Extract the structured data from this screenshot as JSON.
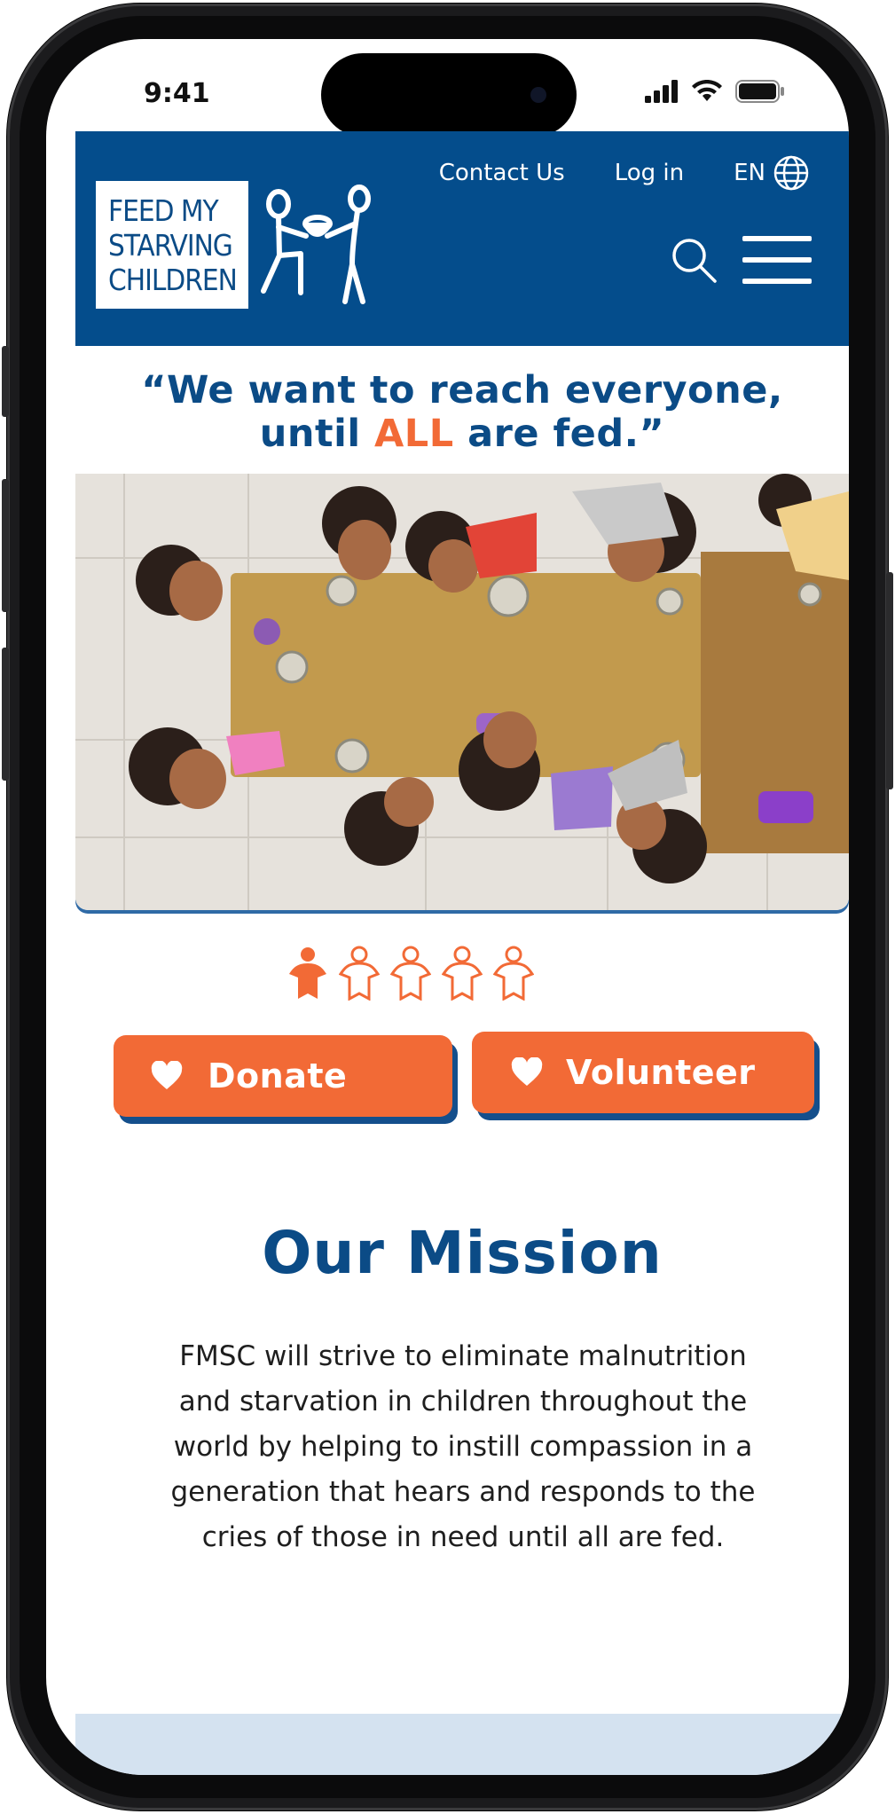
{
  "status_bar": {
    "time": "9:41"
  },
  "header": {
    "logo_lines": [
      "FEED MY",
      "STARVING",
      "CHILDREN"
    ],
    "contact_label": "Contact Us",
    "login_label": "Log in",
    "language": "EN"
  },
  "quote": {
    "before": "“We want to reach everyone,",
    "line2_start": "until ",
    "highlight": "ALL",
    "line2_end": " are fed.”"
  },
  "carousel": {
    "slide_count": 5,
    "active_index": 0
  },
  "actions": {
    "donate_label": "Donate",
    "volunteer_label": "Volunteer"
  },
  "mission": {
    "title": "Our Mission",
    "text": "FMSC will strive to eliminate malnutrition and starvation in children throughout the world by helping to instill compassion in a generation that hears and responds to the cries of those in need until all are fed."
  },
  "colors": {
    "brand_blue": "#044d8c",
    "accent_orange": "#f26a36",
    "band": "#d4e2f0"
  }
}
